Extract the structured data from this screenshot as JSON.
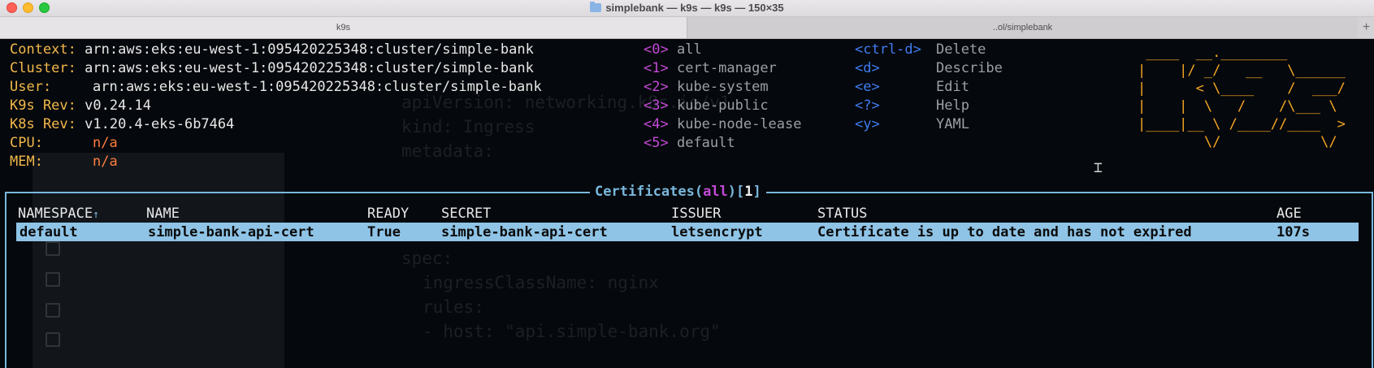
{
  "window": {
    "title": "simplebank — k9s — k9s — 150×35",
    "tabs": [
      {
        "label": "k9s"
      },
      {
        "label": "..ol/simplebank"
      }
    ],
    "add_tab": "+"
  },
  "info": {
    "rows": [
      {
        "label": "Context:",
        "value": "arn:aws:eks:eu-west-1:095420225348:cluster/simple-bank"
      },
      {
        "label": "Cluster:",
        "value": "arn:aws:eks:eu-west-1:095420225348:cluster/simple-bank"
      },
      {
        "label": "User:",
        "value": "arn:aws:eks:eu-west-1:095420225348:cluster/simple-bank"
      },
      {
        "label": "K9s Rev:",
        "value": "v0.24.14"
      },
      {
        "label": "K8s Rev:",
        "value": "v1.20.4-eks-6b7464"
      },
      {
        "label": "CPU:",
        "value": "n/a"
      },
      {
        "label": "MEM:",
        "value": "n/a"
      }
    ]
  },
  "namespaces": [
    {
      "key": "<0>",
      "name": "all"
    },
    {
      "key": "<1>",
      "name": "cert-manager"
    },
    {
      "key": "<2>",
      "name": "kube-system"
    },
    {
      "key": "<3>",
      "name": "kube-public"
    },
    {
      "key": "<4>",
      "name": "kube-node-lease"
    },
    {
      "key": "<5>",
      "name": "default"
    }
  ],
  "hotkeys": [
    {
      "key": "<ctrl-d>",
      "action": "Delete"
    },
    {
      "key": "<d>",
      "action": "Describe"
    },
    {
      "key": "<e>",
      "action": "Edit"
    },
    {
      "key": "<?>",
      "action": "Help"
    },
    {
      "key": "<y>",
      "action": "YAML"
    }
  ],
  "logo_lines": [
    " ____  __.________       ",
    "|    |/ _/   __   \\______",
    "|      < \\____    /  ___/",
    "|    |  \\   /    /\\___ \\ ",
    "|____|__ \\ /____//____  >",
    "        \\/            \\/ "
  ],
  "table": {
    "resource": "Certificates",
    "namespace": "all",
    "count": "1",
    "headers": [
      "NAMESPACE",
      "NAME",
      "READY",
      "SECRET",
      "ISSUER",
      "STATUS",
      "AGE"
    ],
    "sort_arrow": "↑",
    "rows": [
      [
        "default",
        "simple-bank-api-cert",
        "True",
        "simple-bank-api-cert",
        "letsencrypt",
        "Certificate is up to date and has not expired",
        "107s"
      ]
    ]
  },
  "colors": {
    "label": "#f2b84b",
    "na_value": "#ff7c3c",
    "namespace_key": "#c24ad6",
    "hotkey_key": "#3f7cf2",
    "frame": "#79b7dc",
    "selected_row": "#8fc4e6",
    "logo": "#f5a623"
  }
}
